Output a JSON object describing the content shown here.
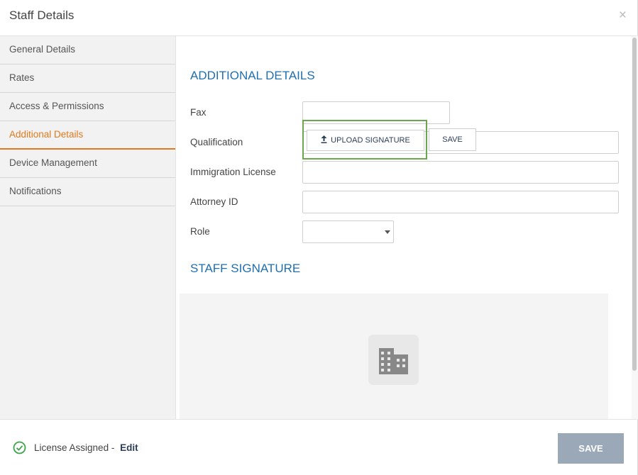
{
  "header": {
    "title": "Staff Details",
    "close_glyph": "×"
  },
  "sidebar": {
    "items": [
      {
        "label": "General Details",
        "active": false
      },
      {
        "label": "Rates",
        "active": false
      },
      {
        "label": "Access & Permissions",
        "active": false
      },
      {
        "label": "Additional Details",
        "active": true
      },
      {
        "label": "Device Management",
        "active": false
      },
      {
        "label": "Notifications",
        "active": false
      }
    ]
  },
  "additional_details": {
    "title": "ADDITIONAL DETAILS",
    "fields": {
      "fax": {
        "label": "Fax",
        "value": ""
      },
      "qualification": {
        "label": "Qualification",
        "value": ""
      },
      "immigration_license": {
        "label": "Immigration License",
        "value": ""
      },
      "attorney_id": {
        "label": "Attorney ID",
        "value": ""
      },
      "role": {
        "label": "Role",
        "selected": ""
      }
    }
  },
  "staff_signature": {
    "title": "STAFF SIGNATURE",
    "placeholder_icon": "building-icon",
    "upload_label": "UPLOAD SIGNATURE",
    "upload_icon": "upload-icon",
    "save_label": "SAVE"
  },
  "footer": {
    "license_text": "License Assigned - ",
    "edit_label": "Edit",
    "save_label": "SAVE",
    "status_icon": "check-circle-icon"
  },
  "colors": {
    "accent": "#e07a1f",
    "section_title": "#1f6fb0",
    "highlight_border": "#6aa84f",
    "disabled_button": "#9ba8b8",
    "check_green": "#3aa548"
  }
}
